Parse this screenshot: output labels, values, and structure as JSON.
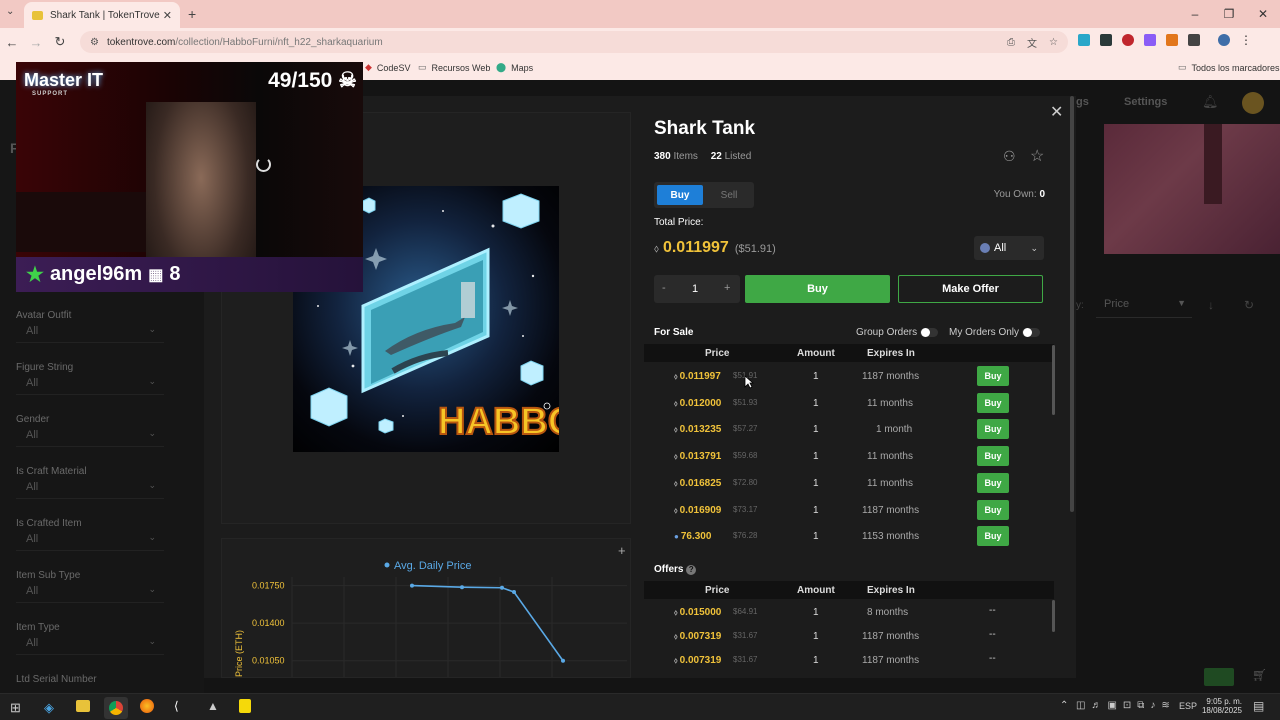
{
  "browser": {
    "tab_title": "Shark Tank | TokenTrove",
    "url_host": "tokentrove.com",
    "url_path": "/collection/HabboFurni/nft_h22_sharkaquarium",
    "bookmarks": [
      "CodeSV",
      "Recursos Web",
      "Maps"
    ],
    "all_bookmarks": "Todos los marcadores"
  },
  "overlay": {
    "logo_line1": "Master IT",
    "logo_line2": "SUPPORT",
    "counter": "49/150",
    "username": "angel96m",
    "sub_count": "8"
  },
  "page": {
    "left_letter": "F",
    "right_nav_1": "gs",
    "right_nav_2": "Settings",
    "sort_label": "y:",
    "sort_value": "Price"
  },
  "filters": [
    {
      "label": "Avatar Outfit",
      "value": "All",
      "top": 310
    },
    {
      "label": "Figure String",
      "value": "All",
      "top": 362
    },
    {
      "label": "Gender",
      "value": "All",
      "top": 414
    },
    {
      "label": "Is Craft Material",
      "value": "All",
      "top": 466
    },
    {
      "label": "Is Crafted Item",
      "value": "All",
      "top": 518
    },
    {
      "label": "Item Sub Type",
      "value": "All",
      "top": 570
    },
    {
      "label": "Item Type",
      "value": "All",
      "top": 622
    },
    {
      "label": "Ltd Serial Number",
      "value": "",
      "top": 674
    }
  ],
  "item": {
    "title": "Shark Tank",
    "items_count": "380",
    "items_label": "Items",
    "listed_count": "22",
    "listed_label": "Listed",
    "buy_tab": "Buy",
    "sell_tab": "Sell",
    "you_own_label": "You Own:",
    "you_own_value": "0",
    "total_price_label": "Total Price:",
    "total_price": "0.011997",
    "total_price_usd": "($51.91)",
    "currency_filter": "All",
    "quantity": "1",
    "minus": "-",
    "plus": "+",
    "buy_label": "Buy",
    "make_offer_label": "Make Offer",
    "artwork_text": "HABBO"
  },
  "for_sale": {
    "title": "For Sale",
    "group_orders": "Group Orders",
    "my_orders_only": "My Orders Only",
    "col_price": "Price",
    "col_amount": "Amount",
    "col_expires": "Expires In",
    "rows": [
      {
        "price": "0.011997",
        "usd": "$51.91",
        "amount": "1",
        "expires": "1187 months",
        "action": "Buy"
      },
      {
        "price": "0.012000",
        "usd": "$51.93",
        "amount": "1",
        "expires": "11 months",
        "action": "Buy"
      },
      {
        "price": "0.013235",
        "usd": "$57.27",
        "amount": "1",
        "expires": "1 month",
        "action": "Buy"
      },
      {
        "price": "0.013791",
        "usd": "$59.68",
        "amount": "1",
        "expires": "11 months",
        "action": "Buy"
      },
      {
        "price": "0.016825",
        "usd": "$72.80",
        "amount": "1",
        "expires": "11 months",
        "action": "Buy"
      },
      {
        "price": "0.016909",
        "usd": "$73.17",
        "amount": "1",
        "expires": "1187 months",
        "action": "Buy"
      },
      {
        "price": "76.300",
        "usd": "$76.28",
        "amount": "1",
        "expires": "1153 months",
        "action": "Buy"
      }
    ]
  },
  "offers": {
    "title": "Offers",
    "col_price": "Price",
    "col_amount": "Amount",
    "col_expires": "Expires In",
    "rows": [
      {
        "price": "0.015000",
        "usd": "$64.91",
        "amount": "1",
        "expires": "8 months",
        "action": "--"
      },
      {
        "price": "0.007319",
        "usd": "$31.67",
        "amount": "1",
        "expires": "1187 months",
        "action": "--"
      },
      {
        "price": "0.007319",
        "usd": "$31.67",
        "amount": "1",
        "expires": "1187 months",
        "action": "--"
      }
    ]
  },
  "chart_data": {
    "type": "line",
    "legend": "Avg. Daily Price",
    "ylabel": "Price (ETH)",
    "yticks": [
      "0.01750",
      "0.01400",
      "0.01050"
    ],
    "ylim": [
      0.0088,
      0.0183
    ],
    "x": [
      1,
      2,
      3,
      4,
      5
    ],
    "series": [
      {
        "name": "Avg. Daily Price",
        "values": [
          0.0175,
          0.01735,
          0.0173,
          0.0169,
          0.0105
        ]
      }
    ],
    "color": "#5aa9e6"
  },
  "taskbar": {
    "lang": "ESP",
    "time": "9:05 p. m.",
    "date": "18/08/2025"
  },
  "colors": {
    "accent_green": "#3fa845",
    "price_yellow": "#f0c23a",
    "tab_blue": "#1e7fd8"
  }
}
